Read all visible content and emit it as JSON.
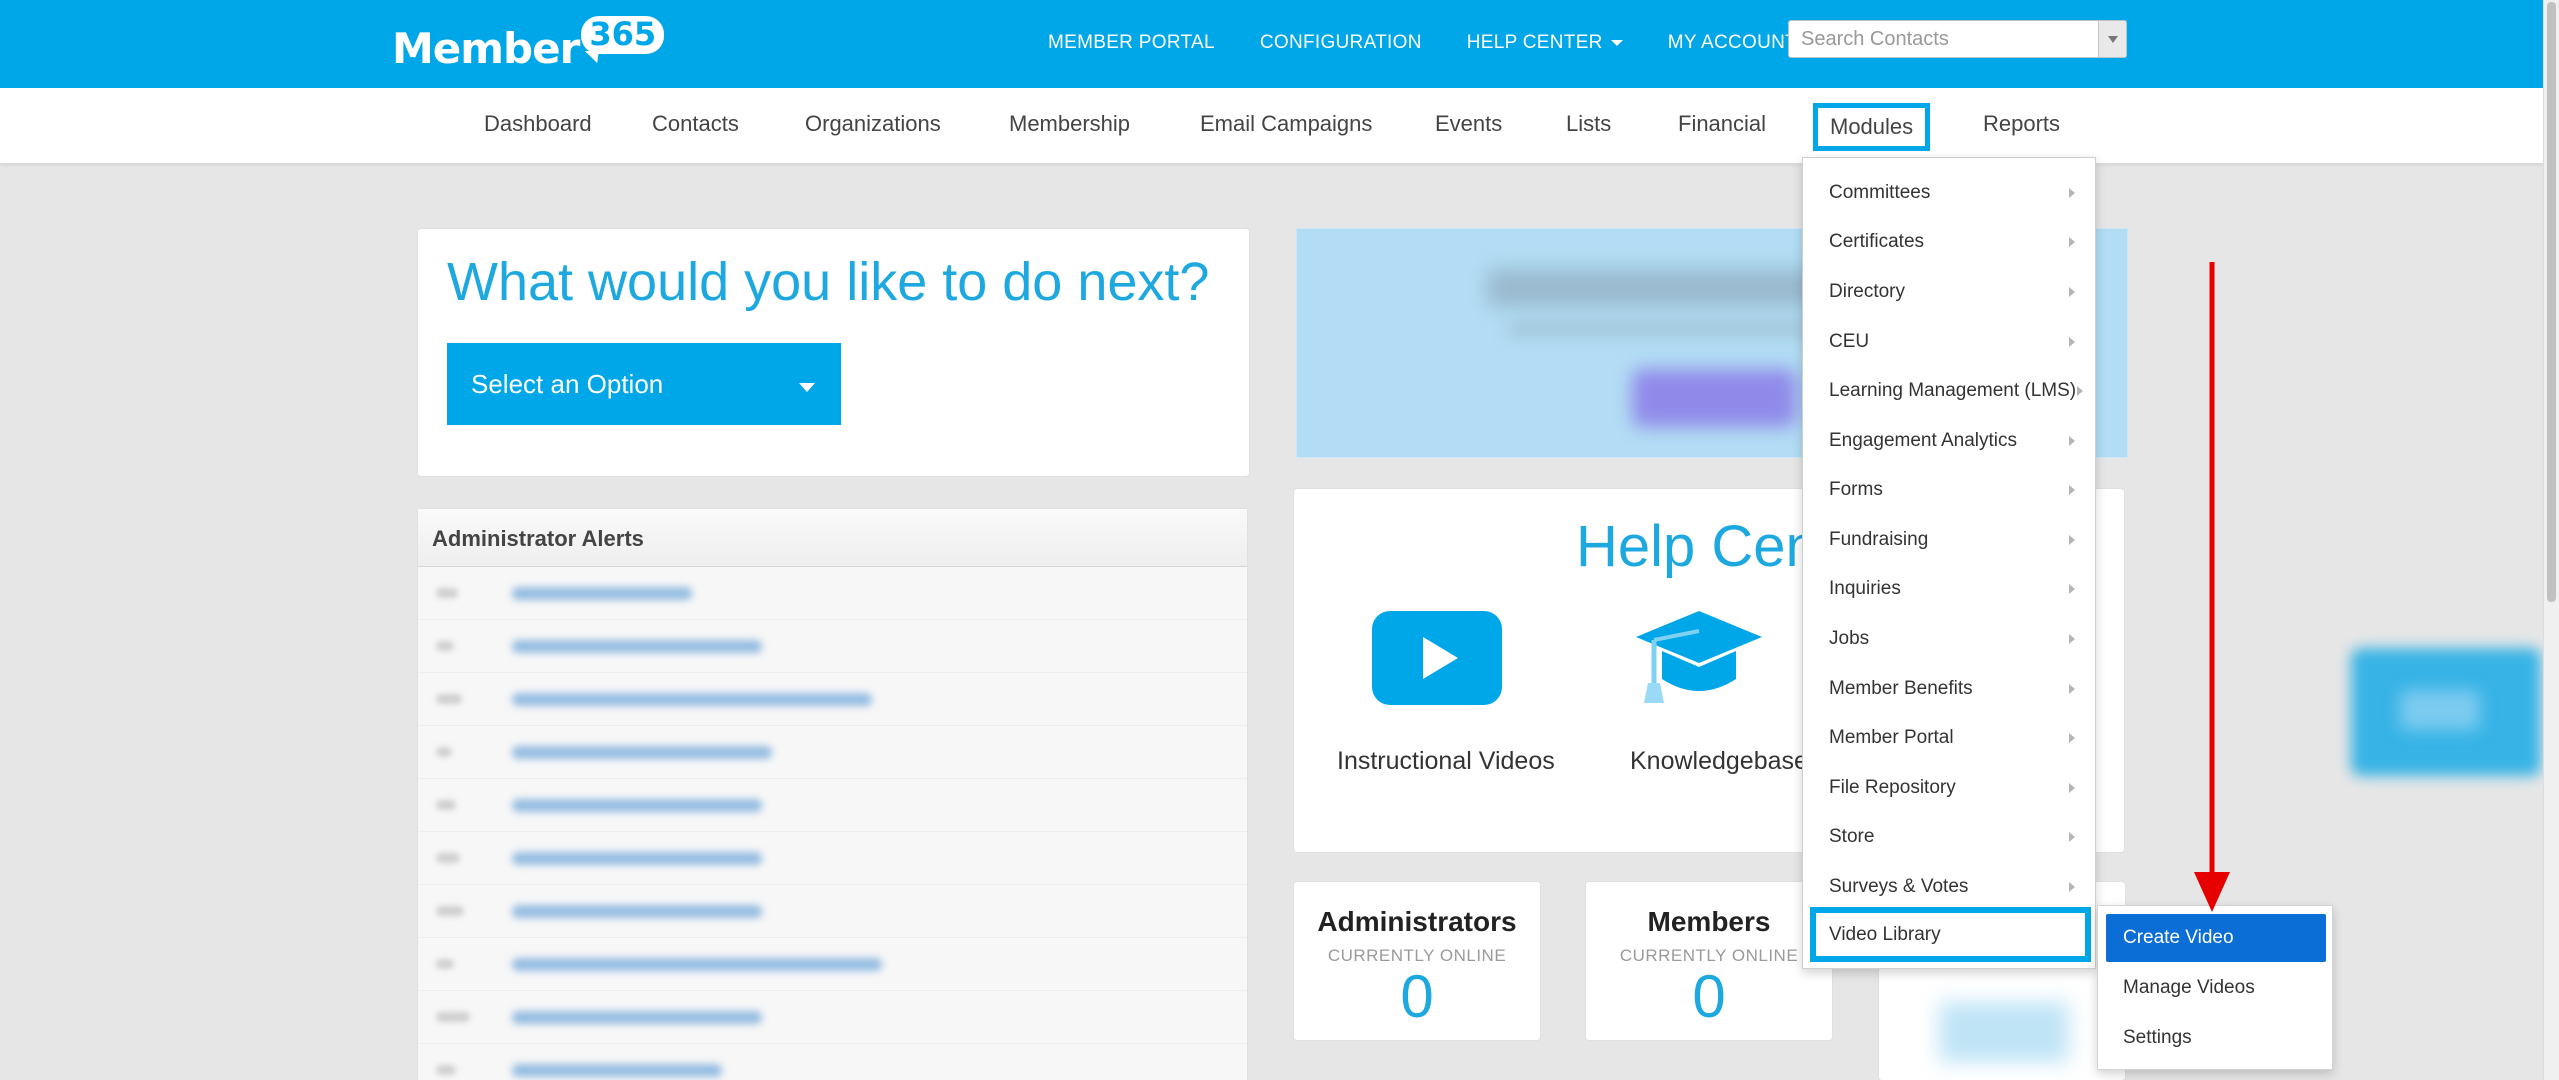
{
  "brand": {
    "logo_word": "Member",
    "logo_number": "365"
  },
  "topnav": {
    "items": [
      {
        "label": "MEMBER PORTAL"
      },
      {
        "label": "CONFIGURATION"
      },
      {
        "label": "HELP CENTER"
      },
      {
        "label": "MY ACCOUNT"
      }
    ]
  },
  "search": {
    "placeholder": "Search Contacts",
    "value": ""
  },
  "subnav": {
    "items": [
      {
        "label": "Dashboard"
      },
      {
        "label": "Contacts"
      },
      {
        "label": "Organizations"
      },
      {
        "label": "Membership"
      },
      {
        "label": "Email Campaigns"
      },
      {
        "label": "Events"
      },
      {
        "label": "Lists"
      },
      {
        "label": "Financial"
      },
      {
        "label": "Modules"
      },
      {
        "label": "Reports"
      }
    ],
    "active": "Modules"
  },
  "next_card": {
    "title": "What would you like to do next?",
    "select_label": "Select an Option"
  },
  "alerts": {
    "title": "Administrator Alerts"
  },
  "help_center": {
    "title": "Help Center",
    "items": [
      {
        "label": "Instructional Videos",
        "icon": "play-video-icon"
      },
      {
        "label": "Knowledgebase",
        "icon": "graduation-cap-icon"
      }
    ]
  },
  "stats": [
    {
      "title": "Administrators",
      "sub": "CURRENTLY ONLINE",
      "value": "0"
    },
    {
      "title": "Members",
      "sub": "CURRENTLY ONLINE",
      "value": "0"
    }
  ],
  "modules_menu": {
    "items": [
      {
        "label": "Committees"
      },
      {
        "label": "Certificates"
      },
      {
        "label": "Directory"
      },
      {
        "label": "CEU"
      },
      {
        "label": "Learning Management (LMS)"
      },
      {
        "label": "Engagement Analytics"
      },
      {
        "label": "Forms"
      },
      {
        "label": "Fundraising"
      },
      {
        "label": "Inquiries"
      },
      {
        "label": "Jobs"
      },
      {
        "label": "Member Benefits"
      },
      {
        "label": "Member Portal"
      },
      {
        "label": "File Repository"
      },
      {
        "label": "Store"
      },
      {
        "label": "Surveys & Votes"
      },
      {
        "label": "Video Library"
      }
    ],
    "highlighted": "Video Library"
  },
  "video_submenu": {
    "items": [
      {
        "label": "Create Video"
      },
      {
        "label": "Manage Videos"
      },
      {
        "label": "Settings"
      }
    ],
    "active": "Create Video"
  },
  "colors": {
    "brand_blue": "#00a7e8",
    "accent_text": "#1ea8e0",
    "submenu_active": "#0a6ed6",
    "annotation_arrow": "#e60000"
  }
}
